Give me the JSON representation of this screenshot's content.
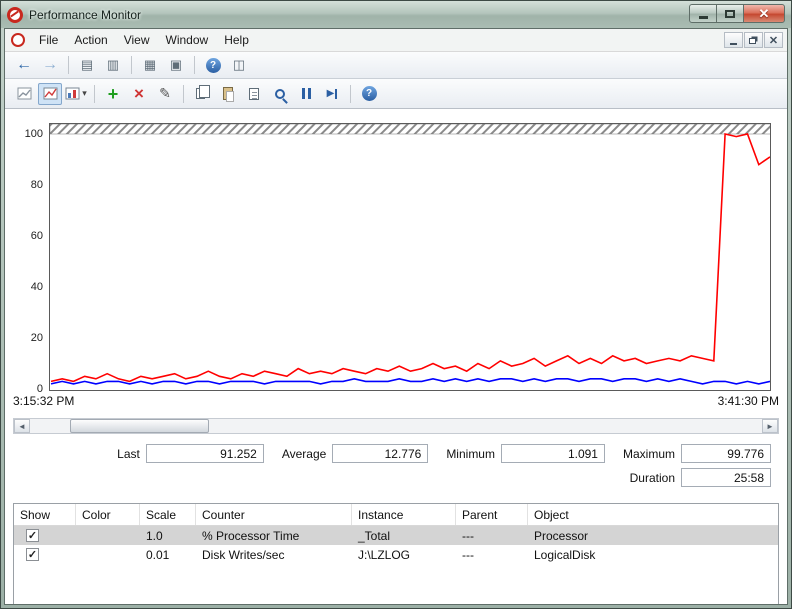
{
  "window": {
    "title": "Performance Monitor"
  },
  "menu": {
    "items": [
      "File",
      "Action",
      "View",
      "Window",
      "Help"
    ]
  },
  "toolbars": {
    "main_icons": [
      "back",
      "forward",
      "show-console-tree",
      "export-list",
      "document",
      "print",
      "help",
      "show-action-pane"
    ],
    "perfmon_icons": [
      "view-log-data",
      "view-current-activity",
      "change-graph-type",
      "add-counter",
      "delete-counter",
      "highlight",
      "copy-properties",
      "paste-counter-list",
      "properties",
      "zoom",
      "freeze-display",
      "update-data",
      "help"
    ]
  },
  "chart_data": {
    "type": "line",
    "title": "",
    "x_start_label": "3:15:32 PM",
    "x_end_label": "3:41:30 PM",
    "ylim": [
      0,
      100
    ],
    "yticks": [
      0,
      20,
      40,
      60,
      80,
      100
    ],
    "grid": false,
    "series": [
      {
        "name": "% Processor Time",
        "color": "#ff0000",
        "values": [
          3,
          4,
          3,
          5,
          4,
          6,
          4,
          3,
          5,
          4,
          5,
          6,
          4,
          5,
          7,
          5,
          4,
          6,
          5,
          7,
          6,
          5,
          8,
          6,
          7,
          6,
          8,
          7,
          6,
          8,
          7,
          9,
          7,
          8,
          10,
          8,
          9,
          7,
          10,
          8,
          11,
          9,
          10,
          12,
          9,
          11,
          13,
          10,
          12,
          10,
          13,
          11,
          12,
          10,
          11,
          12,
          11,
          13,
          12,
          11,
          100,
          99,
          100,
          88,
          91
        ]
      },
      {
        "name": "Disk Writes/sec",
        "color": "#0000ff",
        "values": [
          2,
          3,
          2,
          3,
          2,
          3,
          3,
          2,
          3,
          2,
          3,
          3,
          2,
          3,
          3,
          2,
          3,
          3,
          3,
          2,
          3,
          3,
          3,
          3,
          2,
          3,
          3,
          4,
          3,
          3,
          3,
          4,
          3,
          3,
          4,
          3,
          4,
          3,
          4,
          3,
          4,
          4,
          3,
          4,
          3,
          4,
          4,
          3,
          4,
          4,
          3,
          4,
          4,
          3,
          4,
          3,
          4,
          3,
          2,
          3,
          3,
          2,
          3,
          2,
          3
        ]
      }
    ]
  },
  "scrollbar": {
    "thumb_left_pct": 5.5,
    "thumb_width_pct": 19
  },
  "stats": {
    "last": {
      "label": "Last",
      "value": "91.252"
    },
    "average": {
      "label": "Average",
      "value": "12.776"
    },
    "minimum": {
      "label": "Minimum",
      "value": "1.091"
    },
    "maximum": {
      "label": "Maximum",
      "value": "99.776"
    },
    "duration": {
      "label": "Duration",
      "value": "25:58"
    }
  },
  "legend": {
    "columns": [
      "Show",
      "Color",
      "Scale",
      "Counter",
      "Instance",
      "Parent",
      "Object"
    ],
    "rows": [
      {
        "show": true,
        "selected": true,
        "color": "#ff0000",
        "scale": "1.0",
        "counter": "% Processor Time",
        "instance": "_Total",
        "parent": "---",
        "object": "Processor"
      },
      {
        "show": true,
        "selected": false,
        "color": "#0000ff",
        "scale": "0.01",
        "counter": "Disk Writes/sec",
        "instance": "J:\\LZLOG",
        "parent": "---",
        "object": "LogicalDisk"
      }
    ]
  }
}
